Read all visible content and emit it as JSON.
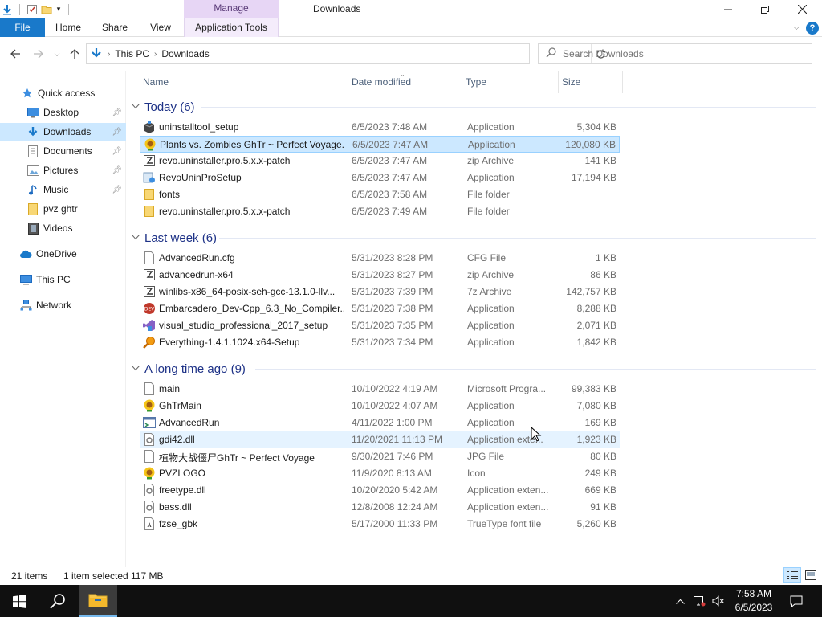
{
  "window": {
    "title": "Downloads",
    "context_tab_header": "Manage",
    "controls": [
      "minimize",
      "maximize",
      "close"
    ]
  },
  "ribbon": {
    "tabs": [
      "File",
      "Home",
      "Share",
      "View",
      "Application Tools"
    ],
    "active_tab": "File",
    "help_label": "?"
  },
  "address": {
    "path": [
      "This PC",
      "Downloads"
    ],
    "search_placeholder": "Search Downloads"
  },
  "navigation": {
    "quick_access": "Quick access",
    "items": [
      {
        "label": "Desktop",
        "icon": "desktop-icon",
        "pinned": true
      },
      {
        "label": "Downloads",
        "icon": "download-arrow-icon",
        "pinned": true,
        "selected": true
      },
      {
        "label": "Documents",
        "icon": "documents-icon",
        "pinned": true
      },
      {
        "label": "Pictures",
        "icon": "pictures-icon",
        "pinned": true
      },
      {
        "label": "Music",
        "icon": "music-note-icon",
        "pinned": true
      },
      {
        "label": "pvz ghtr",
        "icon": "folder-icon"
      },
      {
        "label": "Videos",
        "icon": "videos-icon"
      }
    ],
    "onedrive": "OneDrive",
    "this_pc": "This PC",
    "network": "Network"
  },
  "columns": [
    "Name",
    "Date modified",
    "Type",
    "Size"
  ],
  "groups": [
    {
      "title": "Today (6)",
      "files": [
        {
          "name": "uninstalltool_setup",
          "date": "6/5/2023 7:48 AM",
          "type": "Application",
          "size": "5,304 KB",
          "icon": "installer-box-icon"
        },
        {
          "name": "Plants vs. Zombies GhTr ~ Perfect Voyage...",
          "date": "6/5/2023 7:47 AM",
          "type": "Application",
          "size": "120,080 KB",
          "icon": "pvz-sunflower-icon",
          "selected": true
        },
        {
          "name": "revo.uninstaller.pro.5.x.x-patch",
          "date": "6/5/2023 7:47 AM",
          "type": "zip Archive",
          "size": "141 KB",
          "icon": "zip-archive-icon"
        },
        {
          "name": "RevoUninProSetup",
          "date": "6/5/2023 7:47 AM",
          "type": "Application",
          "size": "17,194 KB",
          "icon": "revo-setup-icon"
        },
        {
          "name": "fonts",
          "date": "6/5/2023 7:58 AM",
          "type": "File folder",
          "size": "",
          "icon": "folder-icon"
        },
        {
          "name": "revo.uninstaller.pro.5.x.x-patch",
          "date": "6/5/2023 7:49 AM",
          "type": "File folder",
          "size": "",
          "icon": "folder-icon"
        }
      ]
    },
    {
      "title": "Last week (6)",
      "files": [
        {
          "name": "AdvancedRun.cfg",
          "date": "5/31/2023 8:28 PM",
          "type": "CFG File",
          "size": "1 KB",
          "icon": "blank-file-icon"
        },
        {
          "name": "advancedrun-x64",
          "date": "5/31/2023 8:27 PM",
          "type": "zip Archive",
          "size": "86 KB",
          "icon": "zip-archive-icon"
        },
        {
          "name": "winlibs-x86_64-posix-seh-gcc-13.1.0-llv...",
          "date": "5/31/2023 7:39 PM",
          "type": "7z Archive",
          "size": "142,757 KB",
          "icon": "zip-archive-icon"
        },
        {
          "name": "Embarcadero_Dev-Cpp_6.3_No_Compiler...",
          "date": "5/31/2023 7:38 PM",
          "type": "Application",
          "size": "8,288 KB",
          "icon": "devcpp-icon"
        },
        {
          "name": "visual_studio_professional_2017_setup",
          "date": "5/31/2023 7:35 PM",
          "type": "Application",
          "size": "2,071 KB",
          "icon": "visual-studio-icon"
        },
        {
          "name": "Everything-1.4.1.1024.x64-Setup",
          "date": "5/31/2023 7:34 PM",
          "type": "Application",
          "size": "1,842 KB",
          "icon": "magnifier-icon"
        }
      ]
    },
    {
      "title": "A long time ago (9)",
      "files": [
        {
          "name": "main",
          "date": "10/10/2022 4:19 AM",
          "type": "Microsoft Progra...",
          "size": "99,383 KB",
          "icon": "blank-file-icon"
        },
        {
          "name": "GhTrMain",
          "date": "10/10/2022 4:07 AM",
          "type": "Application",
          "size": "7,080 KB",
          "icon": "pvz-sunflower-icon"
        },
        {
          "name": "AdvancedRun",
          "date": "4/11/2022 1:00 PM",
          "type": "Application",
          "size": "169 KB",
          "icon": "app-window-icon"
        },
        {
          "name": "gdi42.dll",
          "date": "11/20/2021 11:13 PM",
          "type": "Application exte...",
          "size": "1,923 KB",
          "icon": "dll-gear-icon",
          "hover": true
        },
        {
          "name": "植物大战僵尸GhTr ~ Perfect Voyage",
          "date": "9/30/2021 7:46 PM",
          "type": "JPG File",
          "size": "80 KB",
          "icon": "blank-file-icon"
        },
        {
          "name": "PVZLOGO",
          "date": "11/9/2020 8:13 AM",
          "type": "Icon",
          "size": "249 KB",
          "icon": "pvz-sunflower-icon"
        },
        {
          "name": "freetype.dll",
          "date": "10/20/2020 5:42 AM",
          "type": "Application exten...",
          "size": "669 KB",
          "icon": "dll-gear-icon"
        },
        {
          "name": "bass.dll",
          "date": "12/8/2008 12:24 AM",
          "type": "Application exten...",
          "size": "91 KB",
          "icon": "dll-gear-icon"
        },
        {
          "name": "fzse_gbk",
          "date": "5/17/2000 11:33 PM",
          "type": "TrueType font file",
          "size": "5,260 KB",
          "icon": "font-file-icon"
        }
      ]
    }
  ],
  "status": {
    "items": "21 items",
    "selected": "1 item selected",
    "selected_size": "117 MB"
  },
  "taskbar": {
    "time": "7:58 AM",
    "date": "6/5/2023"
  },
  "colors": {
    "accent": "#1979ca",
    "selection": "#cce8ff",
    "group_title": "#1e3287",
    "context_tab": "#e7d6f5"
  }
}
